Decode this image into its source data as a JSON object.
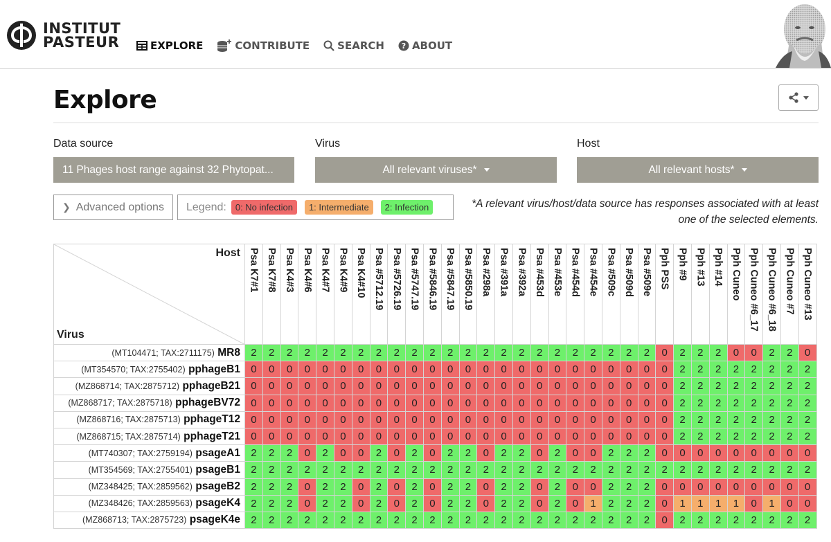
{
  "brand": {
    "line1": "INSTITUT",
    "line2": "PASTEUR"
  },
  "nav": [
    {
      "label": "EXPLORE",
      "icon": "table-icon",
      "active": true
    },
    {
      "label": "CONTRIBUTE",
      "icon": "database-plus-icon",
      "active": false
    },
    {
      "label": "SEARCH",
      "icon": "search-icon",
      "active": false
    },
    {
      "label": "ABOUT",
      "icon": "question-circle-icon",
      "active": false
    }
  ],
  "page": {
    "title": "Explore"
  },
  "filters": {
    "data_source": {
      "label": "Data source",
      "value": "11 Phages host range against 32 Phytopat..."
    },
    "virus": {
      "label": "Virus",
      "value": "All relevant viruses*"
    },
    "host": {
      "label": "Host",
      "value": "All relevant hosts*"
    }
  },
  "advanced_options": "Advanced options",
  "legend": {
    "label": "Legend:",
    "items": [
      {
        "text": "0: No infection",
        "color": "#ef6a6a"
      },
      {
        "text": "1: Intermediate",
        "color": "#f5ae6c"
      },
      {
        "text": "2: Infection",
        "color": "#6ef06b"
      }
    ]
  },
  "note": "*A relevant virus/host/data source has responses associated with at least one of the selected elements.",
  "matrix": {
    "corner_host": "Host",
    "corner_virus": "Virus",
    "hosts": [
      "Psa K7#1",
      "Psa K7#8",
      "Psa K4#3",
      "Psa K4#6",
      "Psa K4#7",
      "Psa K4#9",
      "Psa K4#10",
      "Psa #5712.19",
      "Psa #5726.19",
      "Psa #5747.19",
      "Psa #5846.19",
      "Psa #5847.19",
      "Psa #5850.19",
      "Psa #298a",
      "Psa #391a",
      "Psa #392a",
      "Psa #453d",
      "Psa #453e",
      "Psa #454d",
      "Psa #454e",
      "Psa #509c",
      "Psa #509d",
      "Psa #509e",
      "Pph PSS",
      "Pph #9",
      "Pph #13",
      "Pph #14",
      "Pph Cuneo",
      "Pph Cuneo #6_17",
      "Pph Cuneo #6_18",
      "Pph Cuneo #7",
      "Pph Cuneo #13"
    ],
    "viruses": [
      {
        "acc": "(MT104471; TAX:2711175)",
        "name": "MR8"
      },
      {
        "acc": "(MT354570; TAX:2755402)",
        "name": "pphageB1"
      },
      {
        "acc": "(MZ868714; TAX:2875712)",
        "name": "pphageB21"
      },
      {
        "acc": "(MZ868717; TAX:2875718)",
        "name": "pphageBV72"
      },
      {
        "acc": "(MZ868716; TAX:2875713)",
        "name": "pphageT12"
      },
      {
        "acc": "(MZ868715; TAX:2875714)",
        "name": "pphageT21"
      },
      {
        "acc": "(MT740307; TAX:2759194)",
        "name": "psageA1"
      },
      {
        "acc": "(MT354569; TAX:2755401)",
        "name": "psageB1"
      },
      {
        "acc": "(MZ348425; TAX:2859562)",
        "name": "psageB2"
      },
      {
        "acc": "(MZ348426; TAX:2859563)",
        "name": "psageK4"
      },
      {
        "acc": "(MZ868713; TAX:2875723)",
        "name": "psageK4e"
      }
    ],
    "values": [
      [
        2,
        2,
        2,
        2,
        2,
        2,
        2,
        2,
        2,
        2,
        2,
        2,
        2,
        2,
        2,
        2,
        2,
        2,
        2,
        2,
        2,
        2,
        2,
        0,
        2,
        2,
        2,
        0,
        0,
        2,
        2,
        0
      ],
      [
        0,
        0,
        0,
        0,
        0,
        0,
        0,
        0,
        0,
        0,
        0,
        0,
        0,
        0,
        0,
        0,
        0,
        0,
        0,
        0,
        0,
        0,
        0,
        0,
        2,
        2,
        2,
        2,
        2,
        2,
        2,
        2
      ],
      [
        0,
        0,
        0,
        0,
        0,
        0,
        0,
        0,
        0,
        0,
        0,
        0,
        0,
        0,
        0,
        0,
        0,
        0,
        0,
        0,
        0,
        0,
        0,
        0,
        2,
        2,
        2,
        2,
        2,
        2,
        2,
        2
      ],
      [
        0,
        0,
        0,
        0,
        0,
        0,
        0,
        0,
        0,
        0,
        0,
        0,
        0,
        0,
        0,
        0,
        0,
        0,
        0,
        0,
        0,
        0,
        0,
        0,
        2,
        2,
        2,
        2,
        2,
        2,
        2,
        2
      ],
      [
        0,
        0,
        0,
        0,
        0,
        0,
        0,
        0,
        0,
        0,
        0,
        0,
        0,
        0,
        0,
        0,
        0,
        0,
        0,
        0,
        0,
        0,
        0,
        0,
        2,
        2,
        2,
        2,
        2,
        2,
        2,
        2
      ],
      [
        0,
        0,
        0,
        0,
        0,
        0,
        0,
        0,
        0,
        0,
        0,
        0,
        0,
        0,
        0,
        0,
        0,
        0,
        0,
        0,
        0,
        0,
        0,
        0,
        2,
        2,
        2,
        2,
        2,
        2,
        2,
        2
      ],
      [
        2,
        2,
        2,
        0,
        2,
        0,
        0,
        2,
        0,
        2,
        0,
        2,
        2,
        0,
        2,
        2,
        0,
        2,
        0,
        0,
        2,
        2,
        2,
        0,
        0,
        0,
        0,
        0,
        0,
        0,
        0,
        0
      ],
      [
        2,
        2,
        2,
        2,
        2,
        2,
        2,
        2,
        2,
        2,
        2,
        2,
        2,
        2,
        2,
        2,
        2,
        2,
        2,
        2,
        2,
        2,
        2,
        2,
        2,
        2,
        2,
        2,
        2,
        2,
        2,
        2
      ],
      [
        2,
        2,
        2,
        0,
        2,
        2,
        0,
        2,
        0,
        2,
        0,
        2,
        2,
        0,
        2,
        2,
        0,
        2,
        0,
        0,
        2,
        2,
        2,
        0,
        0,
        0,
        0,
        0,
        0,
        0,
        0,
        0
      ],
      [
        2,
        2,
        2,
        0,
        2,
        2,
        0,
        2,
        0,
        2,
        0,
        2,
        2,
        0,
        2,
        2,
        0,
        2,
        0,
        1,
        2,
        2,
        2,
        0,
        1,
        1,
        1,
        1,
        0,
        1,
        0,
        0
      ],
      [
        2,
        2,
        2,
        2,
        2,
        2,
        2,
        2,
        2,
        2,
        2,
        2,
        2,
        2,
        2,
        2,
        2,
        2,
        2,
        2,
        2,
        2,
        2,
        0,
        2,
        2,
        2,
        2,
        2,
        2,
        2,
        2
      ]
    ]
  }
}
